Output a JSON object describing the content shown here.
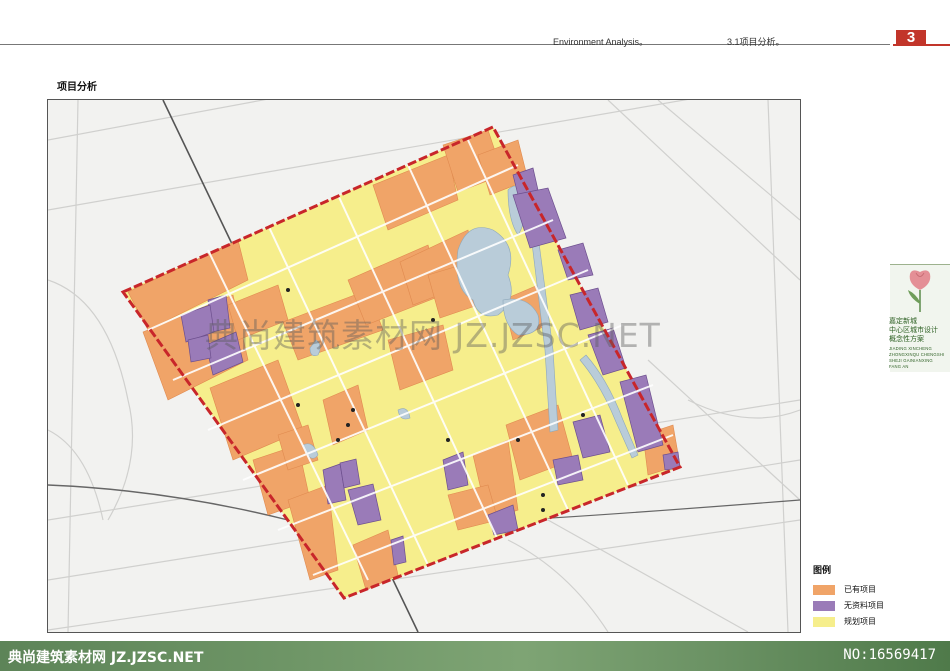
{
  "header": {
    "english": "Environment Analysis。",
    "chinese": "3.1项目分析。",
    "page_number": "3"
  },
  "section_title": "项目分析",
  "brand": {
    "lines_cn": [
      "嘉定新城",
      "中心区城市设计",
      "概念性方案"
    ],
    "lines_pinyin": [
      "JIADING XINCHENG",
      "ZHONGXINQU CHENGSHI",
      "SHEJI GAINIANXING",
      "FANG AN"
    ],
    "icon": "tulip-flower-icon"
  },
  "legend": {
    "title": "图例",
    "items": [
      {
        "label": "已有项目",
        "color": "#f0a468"
      },
      {
        "label": "无资料项目",
        "color": "#9a7bb8"
      },
      {
        "label": "规划项目",
        "color": "#f6ee8c"
      }
    ]
  },
  "colors": {
    "existing": "#f0a468",
    "no_data": "#9a7bb8",
    "planned": "#f6ee8c",
    "boundary": "#c8262a",
    "water": "#b9ccd9",
    "accent": "#c2352a"
  },
  "watermark": "典尚建筑素材网 JZ.JZSC.NET",
  "footer": {
    "left": "典尚建筑素材网 JZ.JZSC.NET",
    "right": "NO:16569417"
  }
}
